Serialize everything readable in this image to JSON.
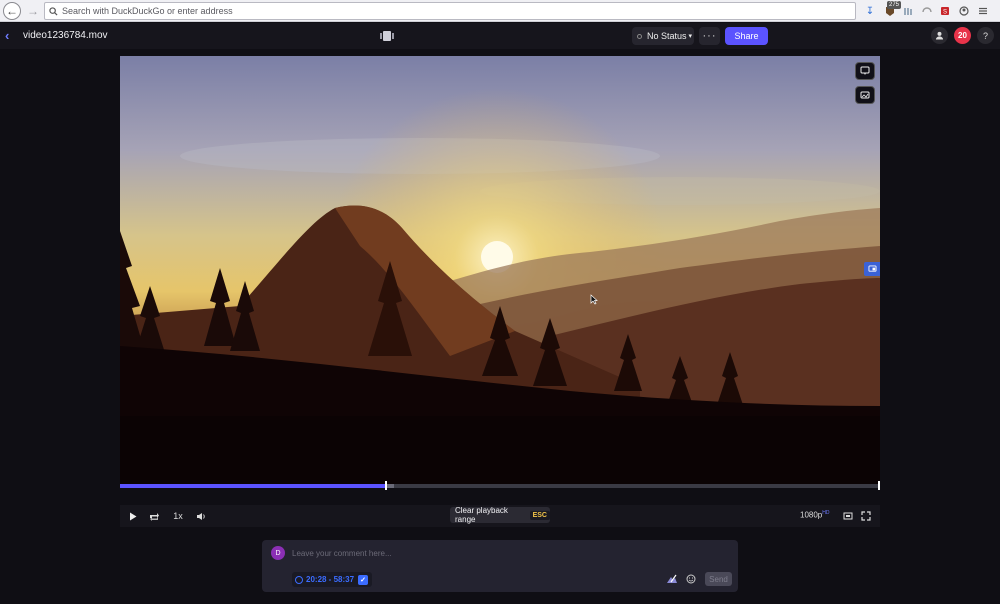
{
  "browser": {
    "address_placeholder": "Search with DuckDuckGo or enter address",
    "extension_badge": "275"
  },
  "header": {
    "file_name": "video1236784.mov",
    "status_label": "No Status",
    "more_label": "···",
    "share_label": "Share",
    "notification_count": "20",
    "help_label": "?"
  },
  "player": {
    "progress_fraction": 0.35,
    "buffered_fraction": 0.36,
    "speed_label": "1x",
    "clear_range_label": "Clear playback range",
    "esc_label": "ESC",
    "quality_label": "1080p",
    "quality_badge": "HD"
  },
  "comment": {
    "avatar_initial": "D",
    "placeholder": "Leave your comment here...",
    "time_range": "20:28 - 58:37",
    "send_label": "Send"
  },
  "colors": {
    "accent": "#5b53ff",
    "notification": "#e8334a",
    "avatar": "#8b2fb5",
    "time_range": "#3b6cff",
    "esc": "#f3c44a"
  }
}
